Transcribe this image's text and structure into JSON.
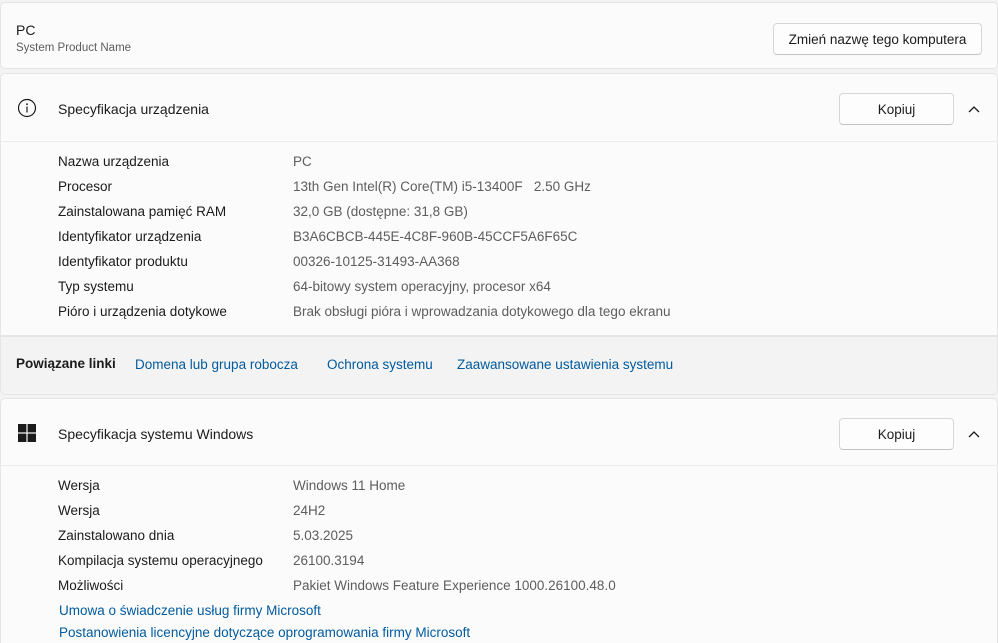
{
  "pc": {
    "name": "PC",
    "subtitle": "System Product Name",
    "rename_label": "Zmień nazwę tego komputera"
  },
  "device_spec": {
    "title": "Specyfikacja urządzenia",
    "icon": "info-icon",
    "copy_label": "Kopiuj",
    "rows": [
      {
        "key": "Nazwa urządzenia",
        "value": "PC"
      },
      {
        "key": "Procesor",
        "value": "13th Gen Intel(R) Core(TM) i5-13400F   2.50 GHz"
      },
      {
        "key": "Zainstalowana pamięć RAM",
        "value": "32,0 GB (dostępne: 31,8 GB)"
      },
      {
        "key": "Identyfikator urządzenia",
        "value": "B3A6CBCB-445E-4C8F-960B-45CCF5A6F65C"
      },
      {
        "key": "Identyfikator produktu",
        "value": "00326-10125-31493-AA368"
      },
      {
        "key": "Typ systemu",
        "value": "64-bitowy system operacyjny, procesor x64"
      },
      {
        "key": "Pióro i urządzenia dotykowe",
        "value": "Brak obsługi pióra i wprowadzania dotykowego dla tego ekranu"
      }
    ]
  },
  "related": {
    "title": "Powiązane linki",
    "links": [
      "Domena lub grupa robocza",
      "Ochrona systemu",
      "Zaawansowane ustawienia systemu"
    ]
  },
  "windows_spec": {
    "title": "Specyfikacja systemu Windows",
    "icon": "windows-logo-icon",
    "copy_label": "Kopiuj",
    "rows": [
      {
        "key": "Wersja",
        "value": "Windows 11 Home"
      },
      {
        "key": "Wersja",
        "value": "24H2"
      },
      {
        "key": "Zainstalowano dnia",
        "value": "5.03.2025"
      },
      {
        "key": "Kompilacja systemu operacyjnego",
        "value": "26100.3194"
      },
      {
        "key": "Możliwości",
        "value": "Pakiet Windows Feature Experience 1000.26100.48.0"
      }
    ],
    "links": [
      "Umowa o świadczenie usług firmy Microsoft",
      "Postanowienia licencyjne dotyczące oprogramowania firmy Microsoft"
    ]
  },
  "colors": {
    "link": "#005a9e",
    "muted_text": "#5d5d5d",
    "card_bg": "#fbfbfb"
  }
}
